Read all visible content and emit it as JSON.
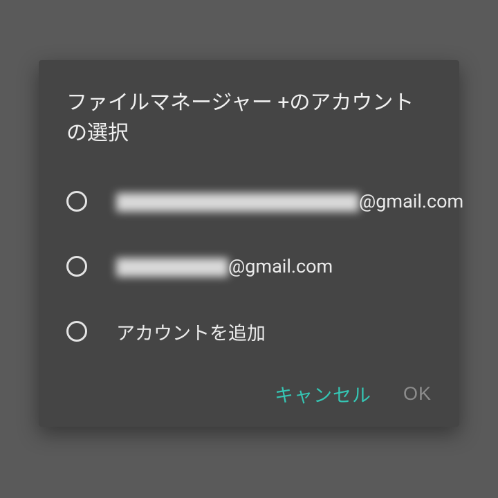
{
  "dialog": {
    "title": "ファイルマネージャー +のアカウントの選択",
    "options": [
      {
        "prefix_obscured": "█████████████",
        "suffix": "@gmail.com"
      },
      {
        "prefix_obscured": "██████",
        "suffix": "@gmail.com"
      },
      {
        "label": "アカウントを追加"
      }
    ],
    "buttons": {
      "cancel": "キャンセル",
      "ok": "OK"
    }
  }
}
